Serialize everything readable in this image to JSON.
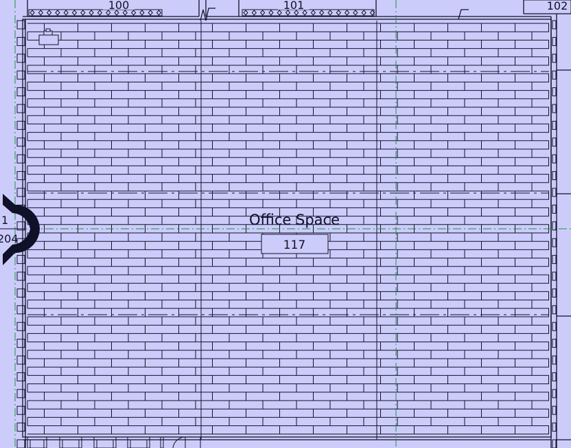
{
  "room": {
    "name": "Office Space",
    "number": "117"
  },
  "adjacent_rooms": [
    "100",
    "101",
    "102"
  ],
  "section_marker": {
    "detail": "1",
    "sheet": "204"
  },
  "colors": {
    "background": "#ccccfb",
    "line": "#101028",
    "gridline": "#1f8f3f"
  },
  "icons": [
    "printer-icon",
    "section-marker-icon",
    "door-swing-icon"
  ]
}
